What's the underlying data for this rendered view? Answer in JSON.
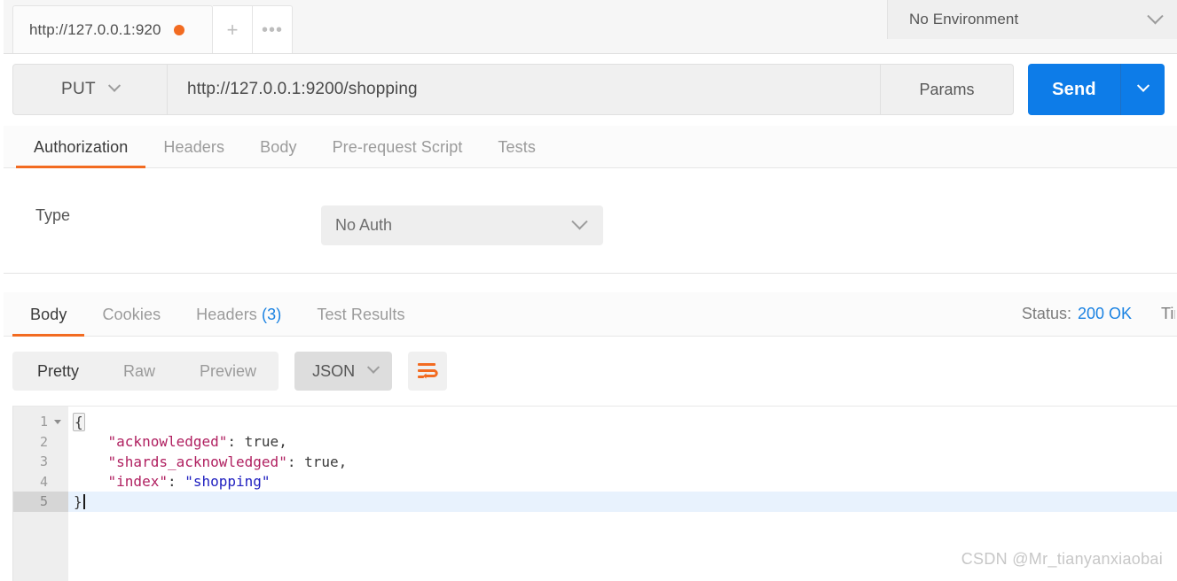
{
  "tabbar": {
    "request_tab_label": "http://127.0.0.1:920",
    "unsaved_indicator": "unsaved-dot",
    "new_tab_icon": "plus-icon",
    "more_tabs_icon": "ellipsis-icon",
    "environment": {
      "selected": "No Environment",
      "chevron_icon": "chevron-down-icon"
    }
  },
  "request": {
    "method": "PUT",
    "method_chevron_icon": "chevron-down-icon",
    "url": "http://127.0.0.1:9200/shopping",
    "params_label": "Params",
    "send_label": "Send",
    "send_chevron_icon": "chevron-down-icon",
    "send_color": "#0d7ce8",
    "tabs": [
      {
        "label": "Authorization",
        "active": true
      },
      {
        "label": "Headers",
        "active": false
      },
      {
        "label": "Body",
        "active": false
      },
      {
        "label": "Pre-request Script",
        "active": false
      },
      {
        "label": "Tests",
        "active": false
      }
    ],
    "active_tab_underline_color": "#f26b21"
  },
  "authorization": {
    "type_label": "Type",
    "type_value": "No Auth",
    "type_chevron_icon": "chevron-down-icon"
  },
  "response": {
    "tabs": [
      {
        "label": "Body",
        "count": "",
        "active": true
      },
      {
        "label": "Cookies",
        "count": "",
        "active": false
      },
      {
        "label": "Headers",
        "count": "(3)",
        "active": false
      },
      {
        "label": "Test Results",
        "count": "",
        "active": false
      }
    ],
    "status_label": "Status:",
    "status_value": "200 OK",
    "status_color": "#1a82e2",
    "time_label_truncated": "Time:",
    "toolbar": {
      "view_modes": [
        {
          "label": "Pretty",
          "active": true
        },
        {
          "label": "Raw",
          "active": false
        },
        {
          "label": "Preview",
          "active": false
        }
      ],
      "format": "JSON",
      "format_chevron_icon": "chevron-down-icon",
      "wrap_icon": "word-wrap-icon",
      "wrap_icon_color": "#f26b21"
    },
    "body": {
      "language": "json",
      "lines": [
        {
          "number": "1",
          "foldable": true,
          "highlighted": false,
          "tokens": [
            {
              "t": "{",
              "c": "brace"
            }
          ]
        },
        {
          "number": "2",
          "foldable": false,
          "highlighted": false,
          "tokens": [
            {
              "t": "    ",
              "c": "plain"
            },
            {
              "t": "\"acknowledged\"",
              "c": "key"
            },
            {
              "t": ": ",
              "c": "punct"
            },
            {
              "t": "true",
              "c": "bool"
            },
            {
              "t": ",",
              "c": "punct"
            }
          ]
        },
        {
          "number": "3",
          "foldable": false,
          "highlighted": false,
          "tokens": [
            {
              "t": "    ",
              "c": "plain"
            },
            {
              "t": "\"shards_acknowledged\"",
              "c": "key"
            },
            {
              "t": ": ",
              "c": "punct"
            },
            {
              "t": "true",
              "c": "bool"
            },
            {
              "t": ",",
              "c": "punct"
            }
          ]
        },
        {
          "number": "4",
          "foldable": false,
          "highlighted": false,
          "tokens": [
            {
              "t": "    ",
              "c": "plain"
            },
            {
              "t": "\"index\"",
              "c": "key"
            },
            {
              "t": ": ",
              "c": "punct"
            },
            {
              "t": "\"shopping\"",
              "c": "str"
            }
          ]
        },
        {
          "number": "5",
          "foldable": false,
          "highlighted": true,
          "cursor": true,
          "tokens": [
            {
              "t": "}",
              "c": "plain"
            }
          ]
        }
      ]
    }
  },
  "watermark": "CSDN @Mr_tianyanxiaobai"
}
